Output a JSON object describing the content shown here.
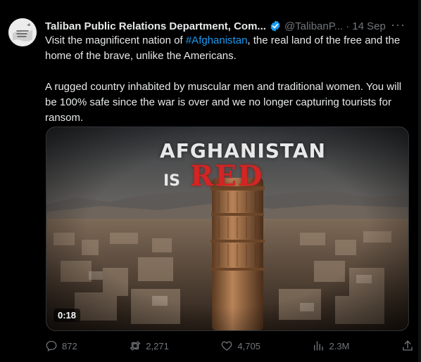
{
  "tweet": {
    "author_name": "Taliban Public Relations Department, Com...",
    "handle": "@TalibanP...",
    "separator": "·",
    "date": "14 Sep",
    "more": "···",
    "text_p1_before": "Visit the magnificent nation of ",
    "text_p1_hashtag": "#Afghanistan",
    "text_p1_after": ", the real land of the free and the home of the brave, unlike the Americans.",
    "text_p2": "A rugged country inhabited by muscular men and traditional women. You will be 100% safe since the war is over and we no longer capturing tourists for ransom.",
    "media": {
      "overlay_line1": "AFGHANISTAN",
      "overlay_is": "IS",
      "overlay_red": "RED",
      "duration": "0:18"
    },
    "stats": {
      "replies": "872",
      "retweets": "2,271",
      "likes": "4,705",
      "views": "2.3M"
    },
    "colors": {
      "background": "#000000",
      "text": "#e7e9ea",
      "muted": "#71767b",
      "link": "#1d9bf0",
      "verified": "#1d9bf0",
      "overlay_red": "#d42424"
    },
    "icons": [
      "verified-badge-icon",
      "more-icon",
      "reply-icon",
      "retweet-icon",
      "like-icon",
      "views-icon",
      "share-icon"
    ]
  }
}
